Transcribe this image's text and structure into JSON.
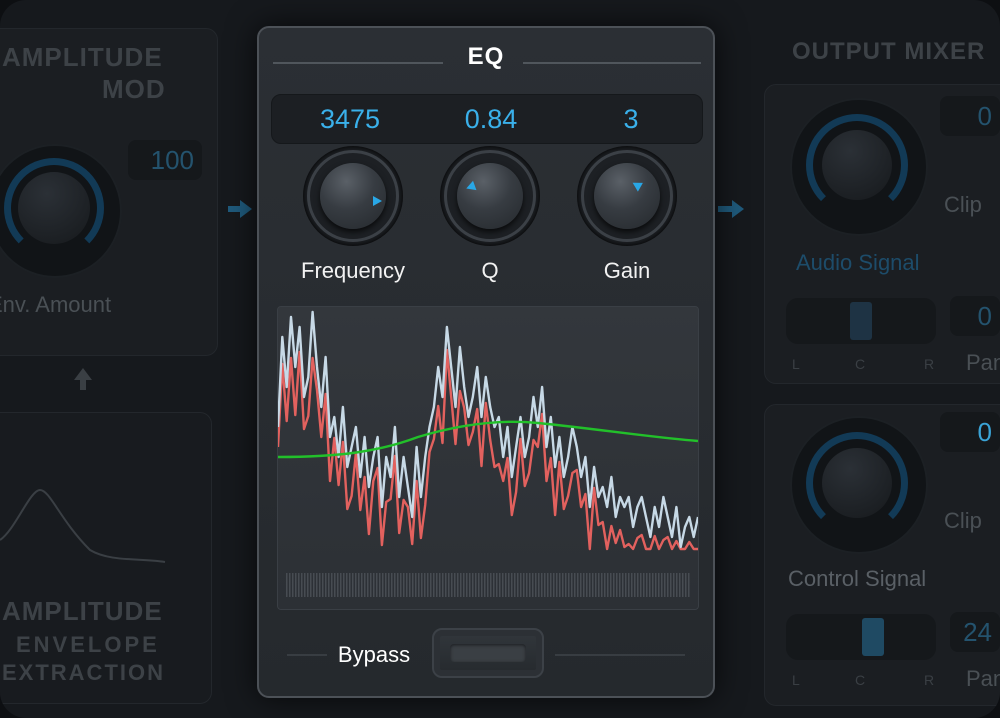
{
  "amplitude_mod": {
    "title_line1": "AMPLITUDE",
    "title_line2": "MOD",
    "value": "100",
    "knob_label": "Env. Amount"
  },
  "envelope_extraction": {
    "title_line1": "AMPLITUDE",
    "title_line2": "ENVELOPE",
    "title_line3": "EXTRACTION"
  },
  "eq": {
    "title": "EQ",
    "frequency": {
      "label": "Frequency",
      "value": "3475"
    },
    "q": {
      "label": "Q",
      "value": "0.84"
    },
    "gain": {
      "label": "Gain",
      "value": "3"
    },
    "bypass_label": "Bypass",
    "bypass_on": false
  },
  "output_mixer": {
    "title": "OUTPUT MIXER",
    "audio_signal": {
      "label": "Audio Signal",
      "value": "0",
      "clip_label": "Clip",
      "pan_value": "0",
      "pan_label": "Pan"
    },
    "control_signal": {
      "label": "Control Signal",
      "value": "0",
      "clip_label": "Clip",
      "pan_value": "24",
      "pan_label": "Pan"
    },
    "lcr_labels": [
      "L",
      "C",
      "R"
    ]
  },
  "colors": {
    "accent_blue": "#3ab0ea",
    "spectrum_white": "#c7d9e6",
    "spectrum_red": "#e2615e",
    "eq_curve_green": "#22c02a"
  },
  "icons": [
    "arrow-right-icon",
    "arrow-up-icon",
    "envelope-curve-icon"
  ]
}
